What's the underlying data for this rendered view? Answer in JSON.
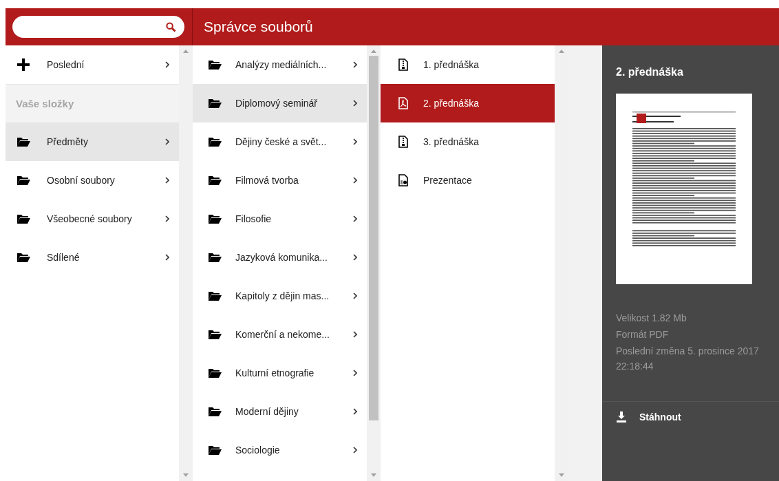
{
  "header": {
    "title": "Správce souborů"
  },
  "sidebar": {
    "items": [
      {
        "kind": "add",
        "label": "Poslední",
        "selected": false
      },
      {
        "kind": "heading",
        "label": "Vaše složky"
      },
      {
        "kind": "folder",
        "label": "Předměty",
        "selected": true
      },
      {
        "kind": "folder",
        "label": "Osobní soubory",
        "selected": false
      },
      {
        "kind": "folder",
        "label": "Všeobecné soubory",
        "selected": false
      },
      {
        "kind": "folder",
        "label": "Sdílené",
        "selected": false
      }
    ]
  },
  "folders": [
    {
      "label": "Analýzy mediálních...",
      "selected": false
    },
    {
      "label": "Diplomový seminář",
      "selected": true
    },
    {
      "label": "Dějiny české a svět...",
      "selected": false
    },
    {
      "label": "Filmová tvorba",
      "selected": false
    },
    {
      "label": "Filosofie",
      "selected": false
    },
    {
      "label": "Jazyková komunika...",
      "selected": false
    },
    {
      "label": "Kapitoly z dějin mas...",
      "selected": false
    },
    {
      "label": "Komerční a nekome...",
      "selected": false
    },
    {
      "label": "Kulturní etnografie",
      "selected": false
    },
    {
      "label": "Moderní dějiny",
      "selected": false
    },
    {
      "label": "Sociologie",
      "selected": false
    }
  ],
  "files": [
    {
      "kind": "archive",
      "label": "1. přednáška",
      "selected": false
    },
    {
      "kind": "pdf",
      "label": "2. přednáška",
      "selected": true
    },
    {
      "kind": "archive",
      "label": "3. přednáška",
      "selected": false
    },
    {
      "kind": "presentation",
      "label": "Prezentace",
      "selected": false
    }
  ],
  "preview": {
    "title": "2. přednáška",
    "details": [
      "Velikost 1.82 Mb",
      "Formát PDF",
      "Poslední změna 5. prosince 2017 22:18:44"
    ],
    "download": "Stáhnout"
  }
}
